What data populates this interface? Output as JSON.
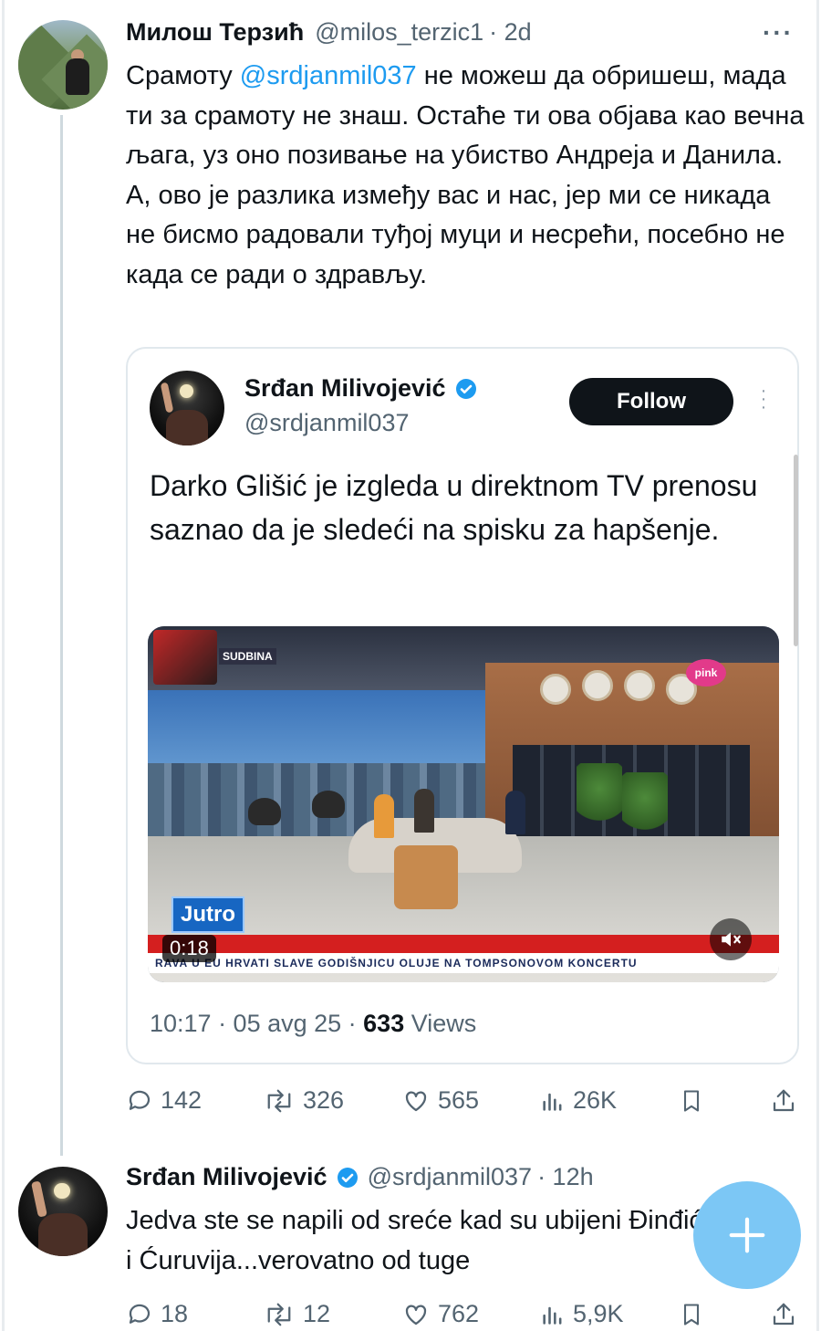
{
  "main_tweet": {
    "name": "Милош Терзић",
    "handle": "@milos_terzic1",
    "time": "· 2d",
    "more": "···",
    "text_before_mention": "Срамоту ",
    "mention": "@srdjanmil037",
    "text_after_mention": " не можеш да обришеш, мада ти за срамоту не знаш. Остаће ти ова објава као вечна љага, уз оно позивање на убиство Андреја и Данила.",
    "text_second": "А, ово је разлика између вас и нас, јер ми се никада не бисмо радовали туђој муци и несрећи, посебно не када се ради о здрављу.",
    "actions": {
      "replies": "142",
      "reposts": "326",
      "likes": "565",
      "views": "26K"
    }
  },
  "quoted_tweet": {
    "name": "Srđan Milivojević",
    "handle": "@srdjanmil037",
    "follow_label": "Follow",
    "text": "Darko Glišić je izgleda u direktnom TV prenosu saznao da je sledeći na spisku za hapšenje.",
    "video": {
      "duration": "0:18",
      "ticker": "RAVA U EU     HRVATI SLAVE GODIŠNJICU OLUJE NA TOMPSONOVOM KONCERTU",
      "logo": "Jutro",
      "brand": "pink",
      "promo": "SUDBINA"
    },
    "time": "10:17 · 05 avg 25 · ",
    "views_count": "633",
    "views_label": " Views"
  },
  "reply_tweet": {
    "name": "Srđan Milivojević",
    "handle": "@srdjanmil037",
    "time": "· 12h",
    "text": "Jedva ste se napili od sreće kad su ubijeni Đinđić i Ćuruvija...verovatno od tuge",
    "actions": {
      "replies": "18",
      "reposts": "12",
      "likes": "762",
      "views": "5,9K"
    }
  },
  "colors": {
    "accent": "#1d9bf0",
    "fab": "#7cc7f5",
    "muted": "#536471"
  }
}
